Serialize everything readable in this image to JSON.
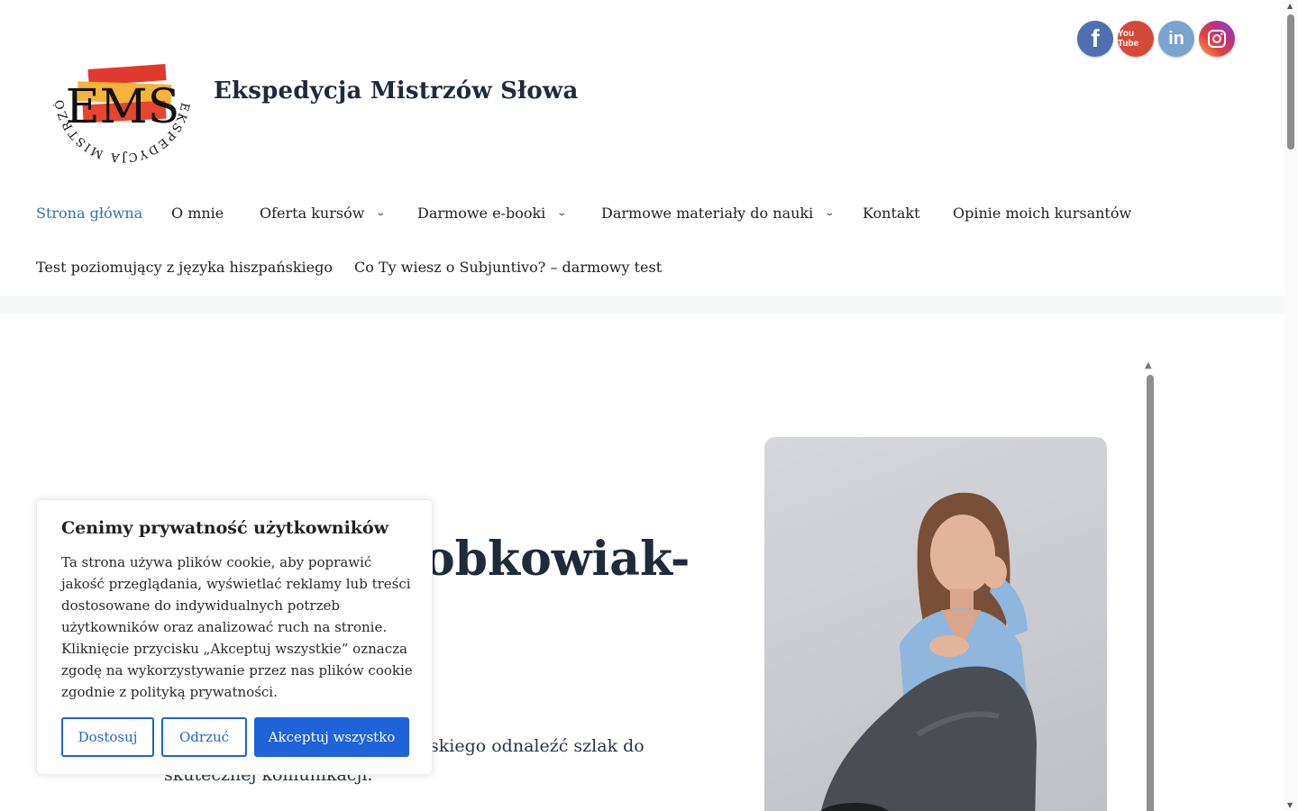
{
  "header": {
    "site_title": "Ekspedycja Mistrzów Słowa",
    "logo_ring_text": "EKSPEDYCJA MISTRZÓW SŁOWA",
    "logo_monogram": "EMS",
    "social": [
      {
        "name": "facebook-icon",
        "glyph": "f"
      },
      {
        "name": "youtube-icon",
        "glyph": "You Tube"
      },
      {
        "name": "linkedin-icon",
        "glyph": "in"
      },
      {
        "name": "instagram-icon",
        "glyph": ""
      }
    ]
  },
  "nav": {
    "row1": [
      {
        "label": "Strona główna",
        "active": true,
        "dropdown": false
      },
      {
        "label": "O mnie",
        "active": false,
        "dropdown": false
      },
      {
        "label": "Oferta kursów",
        "active": false,
        "dropdown": true
      },
      {
        "label": "Darmowe e-booki",
        "active": false,
        "dropdown": true
      },
      {
        "label": "Darmowe materiały do nauki",
        "active": false,
        "dropdown": true
      },
      {
        "label": "Kontakt",
        "active": false,
        "dropdown": false
      },
      {
        "label": "Opinie moich kursantów",
        "active": false,
        "dropdown": false
      }
    ],
    "row2": [
      {
        "label": "Test poziomujący z języka hiszpańskiego"
      },
      {
        "label": "Co Ty wiesz o Subjuntivo? – darmowy test"
      }
    ]
  },
  "main": {
    "heading_visible_part": "obkowiak-",
    "intro_line1": "skiego odnaleźć szlak do",
    "intro_line2": "skutecznej komunikacji."
  },
  "cookie": {
    "title": "Cenimy prywatność użytkowników",
    "text": "Ta strona używa plików cookie, aby poprawić jakość przeglądania, wyświetlać reklamy lub treści dostosowane do indywidualnych potrzeb użytkowników oraz analizować ruch na stronie. Kliknięcie przycisku „Akceptuj wszystkie” oznacza zgodę na wykorzystywanie przez nas plików cookie zgodnie z polityką prywatności.",
    "btn_customize": "Dostosuj",
    "btn_reject": "Odrzuć",
    "btn_accept": "Akceptuj wszystko"
  },
  "colors": {
    "accent": "#1e63d8",
    "nav_active": "#2f73a8"
  }
}
